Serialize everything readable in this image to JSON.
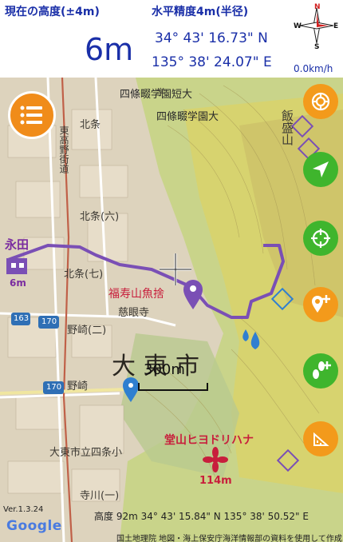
{
  "status": {
    "altitude_label": "現在の高度(±4m)",
    "altitude_value": "6m",
    "accuracy_label": "水平精度4m(半径)",
    "latitude": "34° 43' 16.73\" N",
    "longitude": "135° 38' 24.07\" E",
    "speed": "0.0km/h",
    "compass_letters": {
      "n": "N",
      "e": "E",
      "s": "S",
      "w": "W"
    }
  },
  "map_labels": {
    "school": "学",
    "shijo_university": "四條畷学園短大",
    "shijo_university2": "四條畷学園大",
    "higashi_kouzu": "東高野街道",
    "kitajo": "北条",
    "kitajo7": "北条(七)",
    "kitajo6": "北条(六)",
    "jigenji": "慈眼寺",
    "noki": "野崎(二)",
    "noki2": "野崎",
    "daito_city": "大東市",
    "daito_school": "大東市立四条小",
    "terakawa": "寺川(一)",
    "iimori": "飯盛山",
    "route163": "163",
    "route170": "170",
    "route170b": "170"
  },
  "pins": {
    "start_name": "永田",
    "start_alt": "6m",
    "fukujuyama": "福寿山魚捨",
    "flower_name": "堂山ヒヨドリハナ",
    "flower_alt": "114m"
  },
  "scale": {
    "label": "300m"
  },
  "bottom": {
    "info": "高度 92m  34° 43' 15.84\" N 135° 38' 50.52\" E",
    "credit": "国土地理院 地図・海上保安庁海洋情報部の資料を使用して作成",
    "version": "Ver.1.3.24",
    "google": "Google"
  },
  "icons": {
    "menu": "list-icon",
    "poi": "spiral-icon",
    "navigate": "navigation-arrow-icon",
    "crosshair": "target-icon",
    "add_location": "add-pin-icon",
    "add_footsteps": "footsteps-icon",
    "ruler": "ruler-icon"
  },
  "colors": {
    "text_blue": "#1a2fa8",
    "track": "#7a4fb5",
    "fab_green": "#3fb52d",
    "fab_orange": "#f39a1b",
    "flower_red": "#c81e3c"
  }
}
